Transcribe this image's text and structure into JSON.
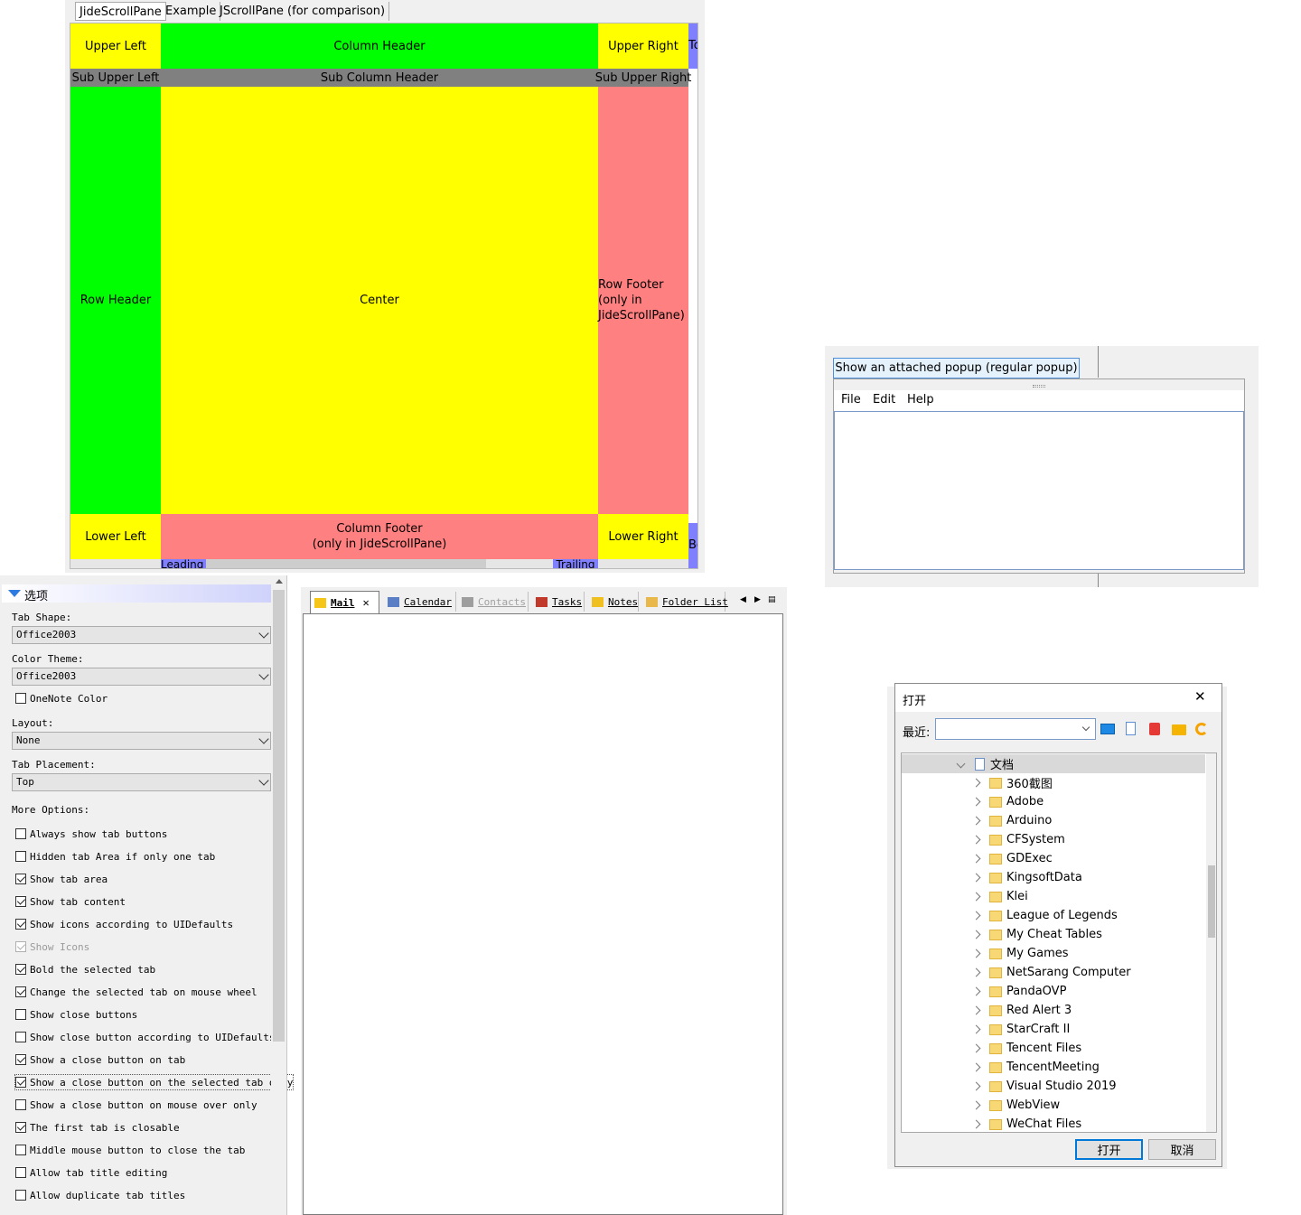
{
  "scroll_pane": {
    "tabs": [
      "JideScrollPane",
      "Example",
      "JScrollPane (for comparison)"
    ],
    "upper_left": "Upper Left",
    "column_header": "Column Header",
    "upper_right": "Upper Right",
    "upper_clip": "To",
    "sub_upper_left": "Sub Upper Left",
    "sub_column_header": "Sub Column Header",
    "sub_upper_right": "Sub Upper Right",
    "row_header": "Row Header",
    "center": "Center",
    "row_footer_1": "Row Footer",
    "row_footer_2": "(only in",
    "row_footer_3": "JideScrollPane)",
    "lower_left": "Lower Left",
    "column_footer_1": "Column Footer",
    "column_footer_2": "(only in JideScrollPane)",
    "lower_right": "Lower Right",
    "lower_clip": "Bo",
    "leading": "Leading",
    "trailing": "Trailing",
    "colors": {
      "green": "#00ff00",
      "yellow": "#ffff00",
      "gray": "#808080",
      "salmon": "#ff8080",
      "blue": "#8080ff"
    }
  },
  "options": {
    "header": "选项",
    "tab_shape_label": "Tab Shape:",
    "tab_shape_value": "Office2003",
    "color_theme_label": "Color Theme:",
    "color_theme_value": "Office2003",
    "onenote": "OneNote Color",
    "layout_label": "Layout:",
    "layout_value": "None",
    "placement_label": "Tab Placement:",
    "placement_value": "Top",
    "more_label": "More Options:",
    "items": [
      {
        "label": "Always show tab buttons",
        "checked": false
      },
      {
        "label": "Hidden tab Area if only one tab",
        "checked": false
      },
      {
        "label": "Show tab area",
        "checked": true
      },
      {
        "label": "Show tab content",
        "checked": true
      },
      {
        "label": "Show icons according to UIDefaults",
        "checked": true
      },
      {
        "label": "Show Icons",
        "checked": true,
        "disabled": true
      },
      {
        "label": "Bold the selected tab",
        "checked": true
      },
      {
        "label": "Change the selected tab on mouse wheel",
        "checked": true
      },
      {
        "label": "Show close buttons",
        "checked": false
      },
      {
        "label": "Show close button according to UIDefaults",
        "checked": false
      },
      {
        "label": "Show a close button on tab",
        "checked": true
      },
      {
        "label": "Show a close button on the selected tab only",
        "checked": true
      },
      {
        "label": "Show a close button on mouse over only",
        "checked": false
      },
      {
        "label": "The first tab is closable",
        "checked": true
      },
      {
        "label": "Middle mouse button to close the tab",
        "checked": false
      },
      {
        "label": "Allow tab title editing",
        "checked": false
      },
      {
        "label": "Allow duplicate tab titles",
        "checked": false
      }
    ]
  },
  "tabbed_pane": {
    "tabs": [
      {
        "label": "Mail",
        "icon": "mail-icon"
      },
      {
        "label": "Calendar",
        "icon": "calendar-icon"
      },
      {
        "label": "Contacts",
        "icon": "contacts-icon"
      },
      {
        "label": "Tasks",
        "icon": "tasks-icon"
      },
      {
        "label": "Notes",
        "icon": "notes-icon"
      },
      {
        "label": "Folder List",
        "icon": "folder-icon"
      }
    ],
    "close_glyph": "✕",
    "left_glyph": "◀",
    "right_glyph": "▶",
    "list_glyph": "▤"
  },
  "popup_demo": {
    "button": "Show an attached popup (regular popup)",
    "menu": [
      "File",
      "Edit",
      "Help"
    ]
  },
  "file_dialog": {
    "title": "打开",
    "close_glyph": "✕",
    "recent_label": "最近:",
    "root": "文档",
    "folders": [
      "360截图",
      "Adobe",
      "Arduino",
      "CFSystem",
      "GDExec",
      "KingsoftData",
      "Klei",
      "League of Legends",
      "My Cheat Tables",
      "My Games",
      "NetSarang Computer",
      "PandaOVP",
      "Red Alert 3",
      "StarCraft II",
      "Tencent Files",
      "TencentMeeting",
      "Visual Studio 2019",
      "WebView",
      "WeChat Files"
    ],
    "open_button": "打开",
    "cancel_button": "取消"
  }
}
